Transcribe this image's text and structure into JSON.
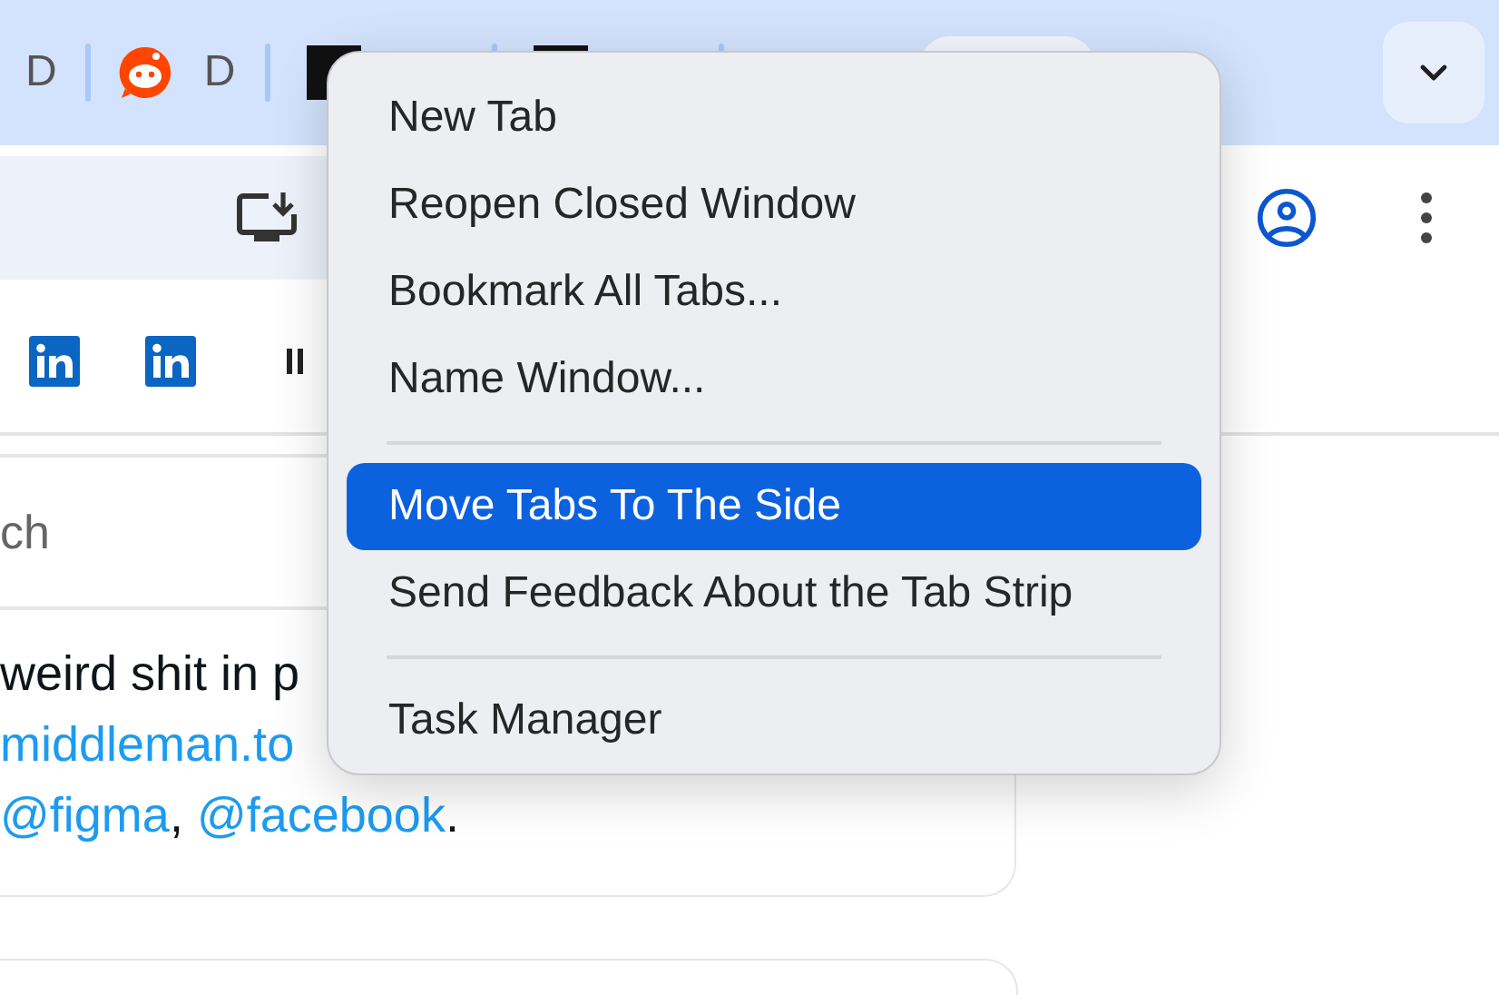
{
  "tabs": [
    {
      "kind": "plain",
      "label": "D"
    },
    {
      "kind": "reddit",
      "label": "D"
    },
    {
      "kind": "dark"
    },
    {
      "kind": "dark"
    }
  ],
  "search": {
    "placeholder": "ch"
  },
  "tweet": {
    "lines": [
      [
        {
          "kind": "text",
          "text": "weird shit in p"
        }
      ],
      [
        {
          "kind": "link",
          "text": "middleman.to"
        }
      ],
      [
        {
          "kind": "link",
          "text": "@figma",
          "after": ", "
        },
        {
          "kind": "link",
          "text": "@facebook",
          "after": "."
        }
      ]
    ]
  },
  "menu": {
    "items": [
      {
        "kind": "item",
        "label": "New Tab",
        "selected": false
      },
      {
        "kind": "item",
        "label": "Reopen Closed Window",
        "selected": false
      },
      {
        "kind": "item",
        "label": "Bookmark All Tabs...",
        "selected": false
      },
      {
        "kind": "item",
        "label": "Name Window...",
        "selected": false
      },
      {
        "kind": "separator"
      },
      {
        "kind": "item",
        "label": "Move Tabs To The Side",
        "selected": true
      },
      {
        "kind": "item",
        "label": "Send Feedback About the Tab Strip",
        "selected": false
      },
      {
        "kind": "separator"
      },
      {
        "kind": "item",
        "label": "Task Manager",
        "selected": false
      }
    ]
  }
}
